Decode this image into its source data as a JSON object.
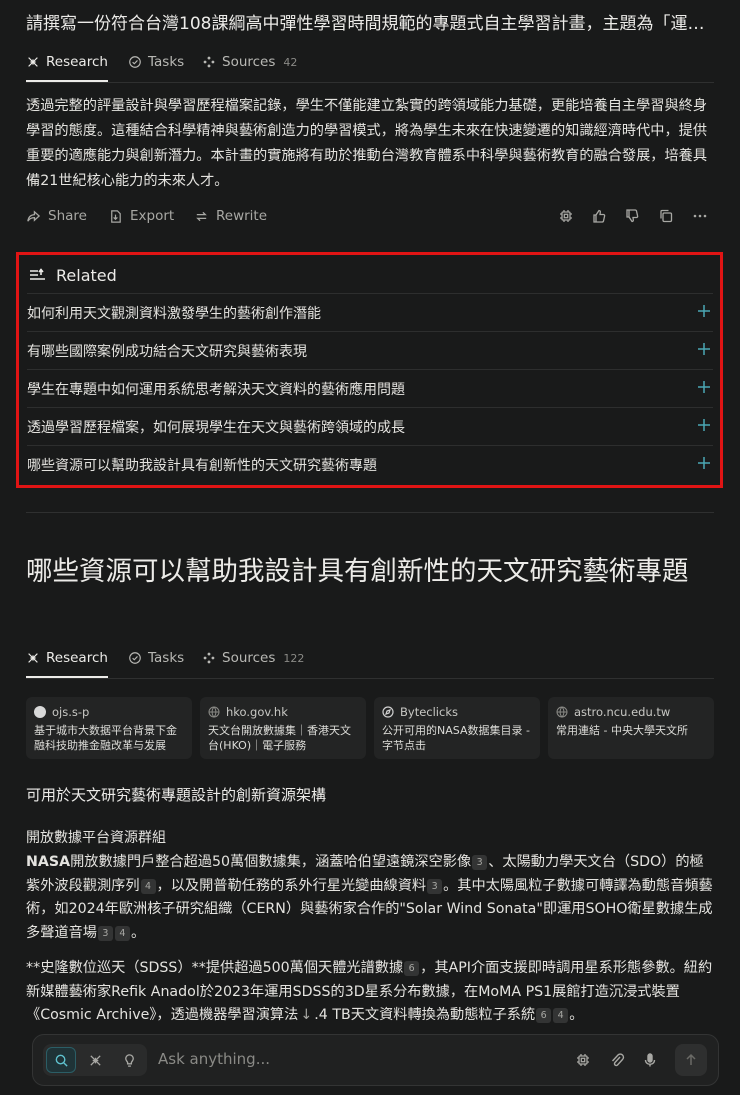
{
  "thread": {
    "title": "請撰寫一份符合台灣108課綱高中彈性學習時間規範的專題式自主學習計畫，主題為「運用..."
  },
  "tabs_top": [
    {
      "label": "Research"
    },
    {
      "label": "Tasks"
    },
    {
      "label": "Sources",
      "count": "42"
    }
  ],
  "answer": {
    "text": "透過完整的評量設計與學習歷程檔案記錄，學生不僅能建立紮實的跨領域能力基礎，更能培養自主學習與終身學習的態度。這種結合科學精神與藝術創造力的學習模式，將為學生未來在快速變遷的知識經濟時代中，提供重要的適應能力與創新潛力。本計畫的實施將有助於推動台灣教育體系中科學與藝術教育的融合發展，培養具備21世紀核心能力的未來人才。"
  },
  "actions": {
    "share": "Share",
    "export": "Export",
    "rewrite": "Rewrite"
  },
  "related": {
    "heading": "Related",
    "items": [
      "如何利用天文觀測資料激發學生的藝術創作潛能",
      "有哪些國際案例成功結合天文研究與藝術表現",
      "學生在專題中如何運用系統思考解決天文資料的藝術應用問題",
      "透過學習歷程檔案，如何展現學生在天文與藝術跨領域的成長",
      "哪些資源可以幫助我設計具有創新性的天文研究藝術專題"
    ]
  },
  "question2": {
    "title": "哪些資源可以幫助我設計具有創新性的天文研究藝術專題"
  },
  "tabs_second": [
    {
      "label": "Research"
    },
    {
      "label": "Tasks"
    },
    {
      "label": "Sources",
      "count": "122"
    }
  ],
  "sources": [
    {
      "domain": "ojs.s-p",
      "title": "基于城市大数据平台背景下金融科技助推金融改革与发展",
      "color": "#d8d8d8"
    },
    {
      "domain": "hko.gov.hk",
      "title": "天文台開放數據集｜香港天文台(HKO)｜電子服務",
      "color": "#555656"
    },
    {
      "domain": "Byteclicks",
      "title": "公开可用的NASA数据集目录 - 字节点击",
      "color": "#cfcfcf"
    },
    {
      "domain": "astro.ncu.edu.tw",
      "title": "常用連結 - 中央大學天文所",
      "color": "#555656"
    }
  ],
  "content": {
    "h3": "可用於天文研究藝術專題設計的創新資源架構",
    "h4": "開放數據平台資源群組",
    "p1": {
      "bold": "NASA",
      "s1": "開放數據門戶整合超過50萬個數據集，涵蓋哈伯望遠鏡深空影像",
      "c1": "3",
      "s2": "、太陽動力學天文台（SDO）的極紫外波段觀測序列",
      "c2": "4",
      "s3": "，以及開普勒任務的系外行星光變曲線資料",
      "c3": "3",
      "s4": "。其中太陽風粒子數據可轉譯為動態音頻藝術，如2024年歐洲核子研究組織（CERN）與藝術家合作的\"Solar Wind Sonata\"即運用SOHO衛星數據生成多聲道音場",
      "c4": "3",
      "c5": "4",
      "s5": "。"
    },
    "p2": {
      "s1": "**史隆數位巡天（SDSS）**提供超過500萬個天體光譜數據",
      "c1": "6",
      "s2": "，其API介面支援即時調用星系形態參數。紐約新媒體藝術家Refik Anadol於2023年運用SDSS的3D星系分布數據，在MoMA PS1展館打造沉浸式裝置《Cosmic Archive》，透過機器學習演算法",
      "s3": ".4 TB天文資料轉換為動態粒子系統",
      "c2": "6",
      "c3": "4",
      "s4": "。"
    }
  },
  "composer": {
    "placeholder": "Ask anything..."
  },
  "colors": {
    "background": "#191a1a",
    "highlight_box": "#e01414",
    "accent": "#2b5e66"
  }
}
